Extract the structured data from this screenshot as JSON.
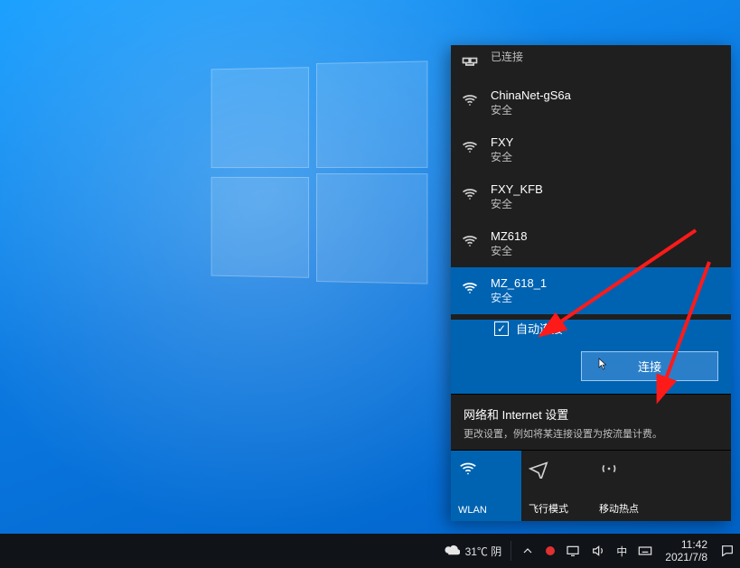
{
  "connected": {
    "label": "已连接"
  },
  "networks": [
    {
      "name": "ChinaNet-gS6a",
      "sub": "安全"
    },
    {
      "name": "FXY",
      "sub": "安全"
    },
    {
      "name": "FXY_KFB",
      "sub": "安全"
    },
    {
      "name": "MZ618",
      "sub": "安全"
    }
  ],
  "selected": {
    "name": "MZ_618_1",
    "sub": "安全",
    "auto_label": "自动连接",
    "connect_label": "连接"
  },
  "settings": {
    "title": "网络和 Internet 设置",
    "sub": "更改设置，例如将某连接设置为按流量计费。"
  },
  "tiles": {
    "wlan": "WLAN",
    "airplane": "飞行模式",
    "hotspot": "移动热点"
  },
  "taskbar": {
    "temp": "31℃ 阴",
    "ime": "中",
    "time": "11:42",
    "date": "2021/7/8"
  }
}
